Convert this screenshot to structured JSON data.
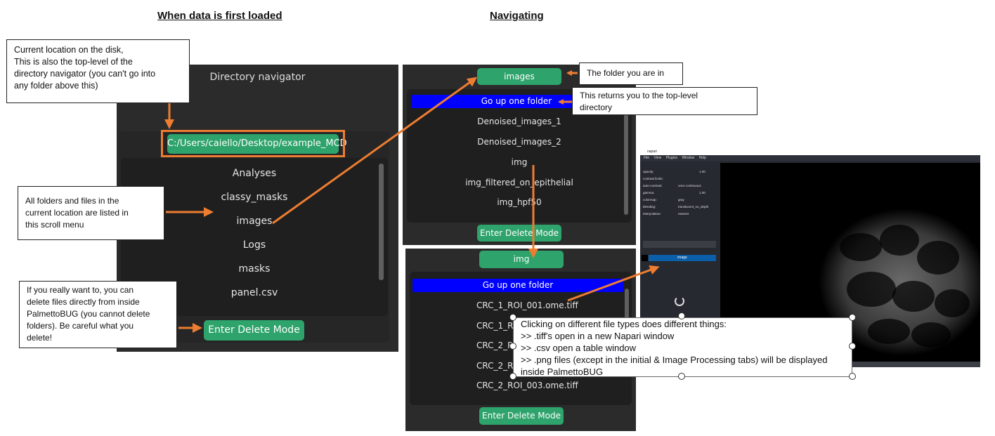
{
  "headings": {
    "left": "When data is first loaded",
    "right": "Navigating"
  },
  "panel1": {
    "title": "Directory navigator",
    "path": "C:/Users/caiello/Desktop/example_MCD",
    "items": [
      "Analyses",
      "classy_masks",
      "images",
      "Logs",
      "masks",
      "panel.csv"
    ],
    "delete_button": "Enter Delete Mode"
  },
  "panel2": {
    "folder": "images",
    "go_up": "Go up one folder",
    "items": [
      "Denoised_images_1",
      "Denoised_images_2",
      "img",
      "img_filtered_on_epithelial",
      "img_hpf50"
    ],
    "delete_button": "Enter Delete Mode"
  },
  "panel3": {
    "folder": "img",
    "go_up": "Go up one folder",
    "items": [
      "CRC_1_ROI_001.ome.tiff",
      "CRC_1_ROI",
      "CRC_2_RO",
      "CRC_2_ROI",
      "CRC_2_ROI_003.ome.tiff"
    ],
    "delete_button": "Enter Delete Mode"
  },
  "callouts": {
    "current_location": [
      "Current location on the disk,",
      "This is also the top-level of the",
      "directory navigator (you can't go into",
      "any folder above this)"
    ],
    "all_folders": [
      "All folders and files in the",
      "current location are listed in",
      "this scroll menu"
    ],
    "delete": [
      "If you really want to, you can",
      "delete files directly from inside",
      "PalmettoBUG (you cannot delete",
      "folders). Be careful what you",
      "delete!"
    ],
    "folder_you_are_in": [
      "The folder you are in"
    ],
    "top_level": [
      "This returns you to the top-level",
      "directory"
    ],
    "file_types": [
      "Clicking on different file types does different things:",
      ">> .tiff's open in a new Napari window",
      ">> .csv open a table window",
      ">> .png files (except in the initial & Image Processing tabs) will be displayed",
      "inside PalmettoBUG"
    ]
  },
  "napari": {
    "title": "napari",
    "menu": [
      "File",
      "View",
      "Plugins",
      "Window",
      "Help"
    ],
    "controls": [
      "opacity:",
      "contrast limits:",
      "auto-contrast:",
      "gamma:",
      "colormap:",
      "blending:",
      "interpolation:"
    ],
    "control_values": [
      "1.00",
      "",
      "once  continuous",
      "1.00",
      "gray",
      "translucent_no_depth",
      "nearest"
    ],
    "layer_name": "image"
  },
  "colors": {
    "arrow": "#ed7d31",
    "button_green": "#2ea36b",
    "go_up_blue": "#0000ff",
    "panel_bg": "#2b2b2b"
  }
}
